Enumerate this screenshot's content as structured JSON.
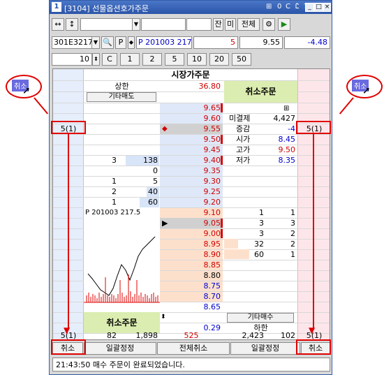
{
  "window": {
    "icon": "1",
    "title": "[3104] 선물옵션호가주문",
    "title_icons": [
      "⊞",
      "0",
      "C",
      "Ꮭ",
      "?",
      "≣"
    ]
  },
  "toolbar1": {
    "arrows": [
      "↔",
      "↕"
    ],
    "buttons": [
      "잔",
      "미",
      "전체"
    ]
  },
  "toolbar2": {
    "code": "301E3217",
    "p_button": "P",
    "name": "P 201003 217",
    "qty": "5",
    "price": "9.55",
    "change": "-4.48"
  },
  "toolbar3": {
    "qty": "10",
    "c_label": "C",
    "qty_buttons": [
      "1",
      "2",
      "5",
      "10",
      "20",
      "50"
    ]
  },
  "grid": {
    "market_order": "시장가주문",
    "upper_label": "상한",
    "upper_value": "36.80",
    "lower_label": "하한",
    "lower_value": "0.29",
    "other_sell": "기타매도",
    "other_buy": "기타매수",
    "cancel_order": "취소주문",
    "prices": [
      "9.65",
      "9.60",
      "9.55",
      "9.50",
      "9.45",
      "9.40",
      "9.35",
      "9.30",
      "9.25",
      "9.20",
      "9.10",
      "9.05",
      "9.00",
      "8.95",
      "8.90",
      "8.85",
      "8.80",
      "8.75",
      "8.70",
      "8.65"
    ],
    "sell_count": [
      "",
      "",
      "",
      "",
      "",
      "3",
      "",
      "1",
      "2",
      "1"
    ],
    "sell_qty": [
      "",
      "",
      "",
      "",
      "",
      "138",
      "0",
      "5",
      "40",
      "60"
    ],
    "buy_qty": [
      "1",
      "3",
      "3",
      "32",
      "60"
    ],
    "buy_count": [
      "1",
      "3",
      "2",
      "2",
      "1"
    ],
    "info": [
      {
        "label": "미결제",
        "value": "4,427"
      },
      {
        "label": "증감",
        "value": "-4"
      },
      {
        "label": "시가",
        "value": "8.45"
      },
      {
        "label": "고가",
        "value": "9.50"
      },
      {
        "label": "저가",
        "value": "8.35"
      }
    ],
    "left_order": "5(1)",
    "right_order": "5(1)",
    "chart_title": "P 201003 217.5",
    "totals": {
      "a": "5(1)",
      "b": "82",
      "c": "1,898",
      "d": "525",
      "e": "2,423",
      "f": "102",
      "g": "5(1)"
    }
  },
  "bottom_buttons": {
    "left_cancel": "취소",
    "bulk_edit_left": "일괄정정",
    "all_cancel": "전체취소",
    "bulk_edit_right": "일괄정정",
    "right_cancel": "취소"
  },
  "status": "21:43:50 매수 주문이 완료되었습니다.",
  "callouts": {
    "left": "취소",
    "right": "취소"
  }
}
